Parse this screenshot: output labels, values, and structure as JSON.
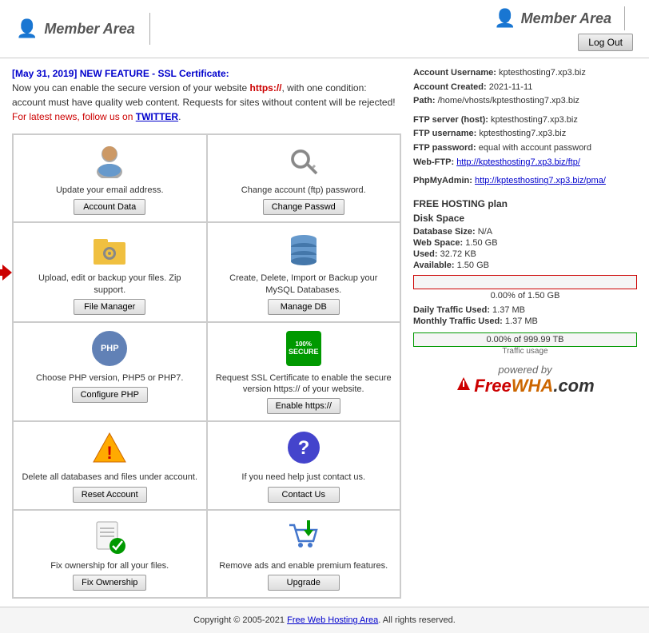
{
  "header": {
    "left_icon": "👤",
    "title": "Member Area",
    "right_icon": "👤",
    "right_title": "Member Area",
    "logout_label": "Log Out"
  },
  "announcement": {
    "date_highlight": "[May 31, 2019]",
    "title_rest": " NEW FEATURE - SSL Certificate:",
    "body1": "Now you can enable the secure version of your website",
    "https": "https://",
    "body2": ", with one condition: account must have quality web content. Requests for sites without content will be rejected!",
    "news_prefix": "For latest news, follow us on",
    "twitter": "TWITTER",
    "news_suffix": "."
  },
  "features": [
    {
      "icon": "person",
      "desc": "Update your email address.",
      "button": "Account Data",
      "has_arrow": false
    },
    {
      "icon": "key",
      "desc": "Change account (ftp) password.",
      "button": "Change Passwd",
      "has_arrow": false
    },
    {
      "icon": "gear",
      "desc": "Upload, edit or backup your files. Zip support.",
      "button": "File Manager",
      "has_arrow": true
    },
    {
      "icon": "db",
      "desc": "Create, Delete, Import or Backup your MySQL Databases.",
      "button": "Manage DB",
      "has_arrow": false
    },
    {
      "icon": "php",
      "desc": "Choose PHP version, PHP5 or PHP7.",
      "button": "Configure PHP",
      "has_arrow": false
    },
    {
      "icon": "ssl",
      "desc": "Request SSL Certificate to enable the secure version https:// of your website.",
      "button": "Enable https://",
      "has_arrow": false
    },
    {
      "icon": "warning",
      "desc": "Delete all databases and files under account.",
      "button": "Reset Account",
      "has_arrow": false
    },
    {
      "icon": "question",
      "desc": "If you need help just contact us.",
      "button": "Contact Us",
      "has_arrow": false
    },
    {
      "icon": "checkfile",
      "desc": "Fix ownership for all your files.",
      "button": "Fix Ownership",
      "has_arrow": false
    },
    {
      "icon": "cart",
      "desc": "Remove ads and enable premium features.",
      "button": "Upgrade",
      "has_arrow": false
    }
  ],
  "account": {
    "username_label": "Account Username:",
    "username": "kptesthosting7.xp3.biz",
    "created_label": "Account Created:",
    "created": "2021-11-11",
    "path_label": "Path:",
    "path": "/home/vhosts/kptesthosting7.xp3.biz",
    "ftp_server_label": "FTP server (host):",
    "ftp_server": "kptesthosting7.xp3.biz",
    "ftp_username_label": "FTP username:",
    "ftp_username": "kptesthosting7.xp3.biz",
    "ftp_password_label": "FTP password:",
    "ftp_password": "equal with account password",
    "webftp_label": "Web-FTP:",
    "webftp_url": "http://kptesthosting7.xp3.biz/ftp/",
    "phpmyadmin_label": "PhpMyAdmin:",
    "phpmyadmin_url": "http://kptesthosting7.xp3.biz/pma/"
  },
  "hosting_plan": {
    "title": "FREE HOSTING plan",
    "db_label": "Database Size:",
    "db_value": "N/A",
    "webspace_label": "Web Space:",
    "webspace_value": "1.50 GB",
    "used_label": "Used:",
    "used_value": "32.72 KB",
    "available_label": "Available:",
    "available_value": "1.50 GB",
    "disk_percent": 0,
    "disk_label": "0.00% of 1.50 GB",
    "daily_traffic_label": "Daily Traffic Used:",
    "daily_traffic": "1.37 MB",
    "monthly_traffic_label": "Monthly Traffic Used:",
    "monthly_traffic": "1.37 MB",
    "traffic_percent": 0,
    "traffic_bar_label": "0.00% of 999.99 TB",
    "traffic_sub_label": "Traffic usage"
  },
  "powered": {
    "text": "powered by",
    "free": "Free",
    "wha": "WHA",
    "com": ".com"
  },
  "footer": {
    "copyright": "Copyright © 2005-2021",
    "link_text": "Free Web Hosting Area",
    "rights": ". All rights reserved."
  }
}
